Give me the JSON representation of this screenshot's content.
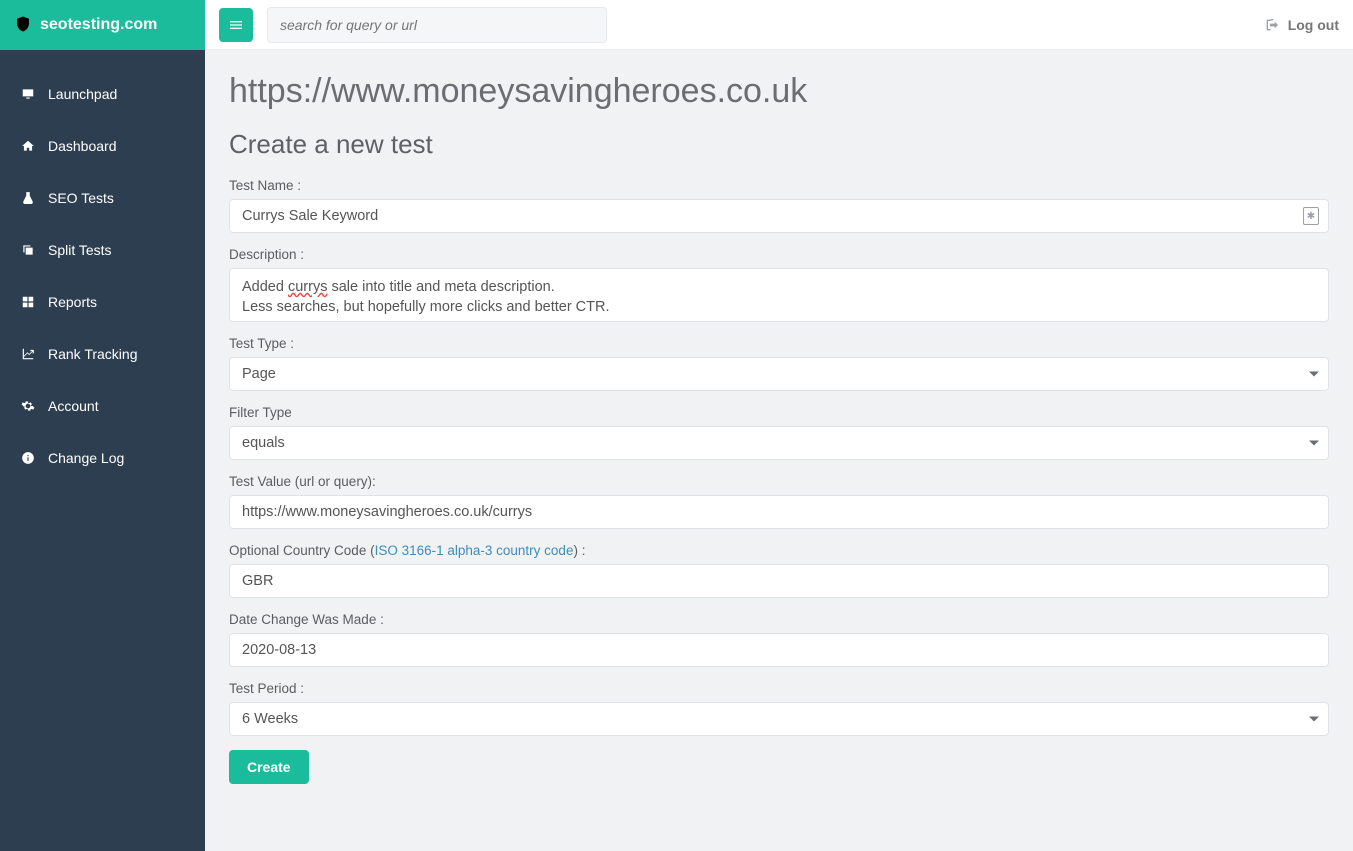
{
  "brand": "seotesting.com",
  "topbar": {
    "search_placeholder": "search for query or url",
    "logout_label": "Log out"
  },
  "sidebar": {
    "items": [
      {
        "label": "Launchpad",
        "icon": "monitor"
      },
      {
        "label": "Dashboard",
        "icon": "home"
      },
      {
        "label": "SEO Tests",
        "icon": "flask"
      },
      {
        "label": "Split Tests",
        "icon": "copy"
      },
      {
        "label": "Reports",
        "icon": "grid"
      },
      {
        "label": "Rank Tracking",
        "icon": "chart"
      },
      {
        "label": "Account",
        "icon": "gear"
      },
      {
        "label": "Change Log",
        "icon": "info"
      }
    ]
  },
  "page": {
    "title": "https://www.moneysavingheroes.co.uk",
    "section_title": "Create a new test"
  },
  "form": {
    "test_name": {
      "label": "Test Name :",
      "value": "Currys Sale Keyword"
    },
    "description": {
      "label": "Description :",
      "value_html": "Added <span class=\"spellcheck\">currys</span> sale into title and meta description.\nLess searches, but hopefully more clicks and better CTR."
    },
    "test_type": {
      "label": "Test Type :",
      "value": "Page"
    },
    "filter_type": {
      "label": "Filter Type",
      "value": "equals"
    },
    "test_value": {
      "label": "Test Value (url or query):",
      "value": "https://www.moneysavingheroes.co.uk/currys"
    },
    "country_code": {
      "label_prefix": "Optional Country Code (",
      "link_text": "ISO 3166-1 alpha-3 country code",
      "label_suffix": ") :",
      "value": "GBR"
    },
    "date_change": {
      "label": "Date Change Was Made :",
      "value": "2020-08-13"
    },
    "test_period": {
      "label": "Test Period :",
      "value": "6 Weeks"
    },
    "submit_label": "Create"
  }
}
